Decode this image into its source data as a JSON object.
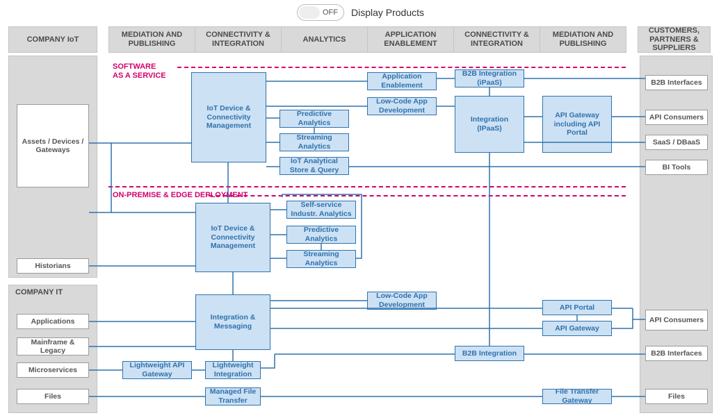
{
  "toggle": {
    "state": "OFF",
    "label": "Display Products"
  },
  "columns": {
    "left": "COMPANY IoT",
    "mid": [
      "MEDIATION AND PUBLISHING",
      "CONNECTIVITY & INTEGRATION",
      "ANALYTICS",
      "APPLICATION ENABLEMENT",
      "CONNECTIVITY & INTEGRATION",
      "MEDIATION AND PUBLISHING"
    ],
    "right": "CUSTOMERS, PARTNERS & SUPPLIERS"
  },
  "sections": {
    "saas": "SOFTWARE\nAS A SERVICE",
    "onprem": "ON-PREMISE & EDGE DEPLOYMENT",
    "it": "COMPANY IT"
  },
  "left_iot": {
    "devices": "Assets / Devices / Gateways",
    "historians": "Historians"
  },
  "left_it": {
    "apps": "Applications",
    "mainframe": "Mainframe & Legacy",
    "micro": "Microservices",
    "files": "Files"
  },
  "right": {
    "b2b": "B2B Interfaces",
    "api": "API Consumers",
    "saas": "SaaS / DBaaS",
    "bi": "BI Tools",
    "api2": "API Consumers",
    "b2b2": "B2B Interfaces",
    "files": "Files"
  },
  "saas_nodes": {
    "iot": "IoT Device & Connectivity Management",
    "pred": "Predictive Analytics",
    "stream": "Streaming Analytics",
    "store": "IoT Analytical Store & Query",
    "appenable": "Application Enablement",
    "lowcode": "Low-Code App Development",
    "b2b": "B2B Integration (iPaaS)",
    "ipaas": "Integration (IPaaS)",
    "apigw": "API Gateway including API Portal"
  },
  "onprem_nodes": {
    "iot": "IoT Device & Connectivity Management",
    "self": "Self-service Industr. Analytics",
    "pred": "Predictive Analytics",
    "stream": "Streaming Analytics"
  },
  "it_nodes": {
    "integ": "Integration & Messaging",
    "lowcode": "Low-Code App Development",
    "lwgw": "Lightweight API Gateway",
    "lwint": "Lightweight Integration",
    "mft": "Managed File Transfer",
    "apiportal": "API Portal",
    "apigw": "API Gateway",
    "b2b": "B2B Integration",
    "ftgw": "File Transfer Gateway"
  }
}
